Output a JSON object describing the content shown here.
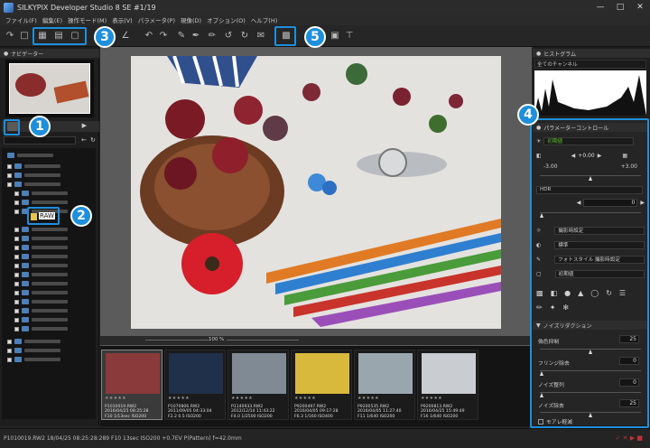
{
  "window": {
    "title": "SILKYPIX Developer Studio 8 SE  #1/19"
  },
  "menu": [
    "ファイル(F)",
    "編集(E)",
    "操作モード(M)",
    "表示(V)",
    "パラメータ(P)",
    "現像(D)",
    "オプション(O)",
    "ヘルプ(H)"
  ],
  "panels": {
    "navigator": "ナビゲーター",
    "histogram": "ヒストグラム",
    "all_channels": "全てのチャンネル",
    "param_control": "パラメーターコントロール",
    "noise": "ノイズリダクション"
  },
  "badges": [
    "1",
    "2",
    "3",
    "4",
    "5"
  ],
  "tree": {
    "raw_label": "RAW"
  },
  "zoom": {
    "value": "100",
    "unit": "%"
  },
  "params": {
    "wb": "初期値",
    "exposure": "+0.00",
    "exp_min": "-3.00",
    "exp_max": "+3.00",
    "hdr": "HDR",
    "hdr_val": "0",
    "contrast_preset": "撮影時設定",
    "tone": "標準",
    "color_style": "フォトスタイル 撮影時設定",
    "sharp": "初期値"
  },
  "noise": {
    "rows": [
      {
        "label": "偽色抑制",
        "value": "25"
      },
      {
        "label": "フリンジ除去",
        "value": "0"
      },
      {
        "label": "ノイズ整列",
        "value": "0"
      },
      {
        "label": "ノイズ除去",
        "value": "25"
      }
    ],
    "model_label": "モアレ軽減"
  },
  "thumbs": [
    {
      "name": "P1010019.RW2",
      "date": "2016/04/25 08:25:28",
      "exif": "F10 1/13sec ISO200",
      "color": "#8a3a3a",
      "sel": true
    },
    {
      "name": "P1070806.RW2",
      "date": "2011/09/05 04:33:04",
      "exif": "F2.2 0.5 ISO200",
      "color": "#20304a",
      "sel": false
    },
    {
      "name": "P1140933.RW2",
      "date": "2012/12/14 11:43:22",
      "exif": "F4.0 1/2500 ISO200",
      "color": "#7f8a94",
      "sel": false
    },
    {
      "name": "P9200497.RW2",
      "date": "2016/04/05 09:17:28",
      "exif": "F6.3 1/160 ISO400",
      "color": "#d9b93c",
      "sel": false
    },
    {
      "name": "P9200535.RW2",
      "date": "2016/04/05 11:27:40",
      "exif": "F11 1/640 ISO200",
      "color": "#9aa6ae",
      "sel": false
    },
    {
      "name": "P9200813.RW2",
      "date": "2016/04/25 15:49:49",
      "exif": "F16 1/640 ISO200",
      "color": "#c9ccd0",
      "sel": false
    }
  ],
  "status": "P1010019.RW2  18/04/25 08:25:28:289  F10 13sec ISO200 +0.7EV  P(Pattern)  f=42.0mm",
  "accent": "#1e8fdc"
}
